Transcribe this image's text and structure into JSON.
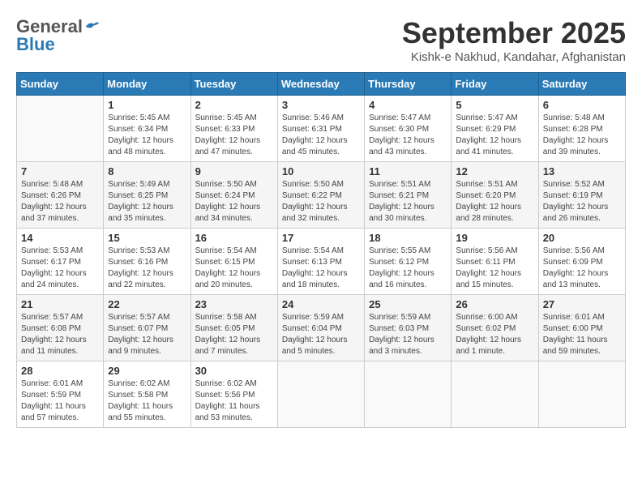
{
  "header": {
    "logo": {
      "general": "General",
      "blue": "Blue"
    },
    "title": "September 2025",
    "subtitle": "Kishk-e Nakhud, Kandahar, Afghanistan"
  },
  "weekdays": [
    "Sunday",
    "Monday",
    "Tuesday",
    "Wednesday",
    "Thursday",
    "Friday",
    "Saturday"
  ],
  "weeks": [
    [
      {
        "day": "",
        "info": ""
      },
      {
        "day": "1",
        "info": "Sunrise: 5:45 AM\nSunset: 6:34 PM\nDaylight: 12 hours\nand 48 minutes."
      },
      {
        "day": "2",
        "info": "Sunrise: 5:45 AM\nSunset: 6:33 PM\nDaylight: 12 hours\nand 47 minutes."
      },
      {
        "day": "3",
        "info": "Sunrise: 5:46 AM\nSunset: 6:31 PM\nDaylight: 12 hours\nand 45 minutes."
      },
      {
        "day": "4",
        "info": "Sunrise: 5:47 AM\nSunset: 6:30 PM\nDaylight: 12 hours\nand 43 minutes."
      },
      {
        "day": "5",
        "info": "Sunrise: 5:47 AM\nSunset: 6:29 PM\nDaylight: 12 hours\nand 41 minutes."
      },
      {
        "day": "6",
        "info": "Sunrise: 5:48 AM\nSunset: 6:28 PM\nDaylight: 12 hours\nand 39 minutes."
      }
    ],
    [
      {
        "day": "7",
        "info": "Sunrise: 5:48 AM\nSunset: 6:26 PM\nDaylight: 12 hours\nand 37 minutes."
      },
      {
        "day": "8",
        "info": "Sunrise: 5:49 AM\nSunset: 6:25 PM\nDaylight: 12 hours\nand 35 minutes."
      },
      {
        "day": "9",
        "info": "Sunrise: 5:50 AM\nSunset: 6:24 PM\nDaylight: 12 hours\nand 34 minutes."
      },
      {
        "day": "10",
        "info": "Sunrise: 5:50 AM\nSunset: 6:22 PM\nDaylight: 12 hours\nand 32 minutes."
      },
      {
        "day": "11",
        "info": "Sunrise: 5:51 AM\nSunset: 6:21 PM\nDaylight: 12 hours\nand 30 minutes."
      },
      {
        "day": "12",
        "info": "Sunrise: 5:51 AM\nSunset: 6:20 PM\nDaylight: 12 hours\nand 28 minutes."
      },
      {
        "day": "13",
        "info": "Sunrise: 5:52 AM\nSunset: 6:19 PM\nDaylight: 12 hours\nand 26 minutes."
      }
    ],
    [
      {
        "day": "14",
        "info": "Sunrise: 5:53 AM\nSunset: 6:17 PM\nDaylight: 12 hours\nand 24 minutes."
      },
      {
        "day": "15",
        "info": "Sunrise: 5:53 AM\nSunset: 6:16 PM\nDaylight: 12 hours\nand 22 minutes."
      },
      {
        "day": "16",
        "info": "Sunrise: 5:54 AM\nSunset: 6:15 PM\nDaylight: 12 hours\nand 20 minutes."
      },
      {
        "day": "17",
        "info": "Sunrise: 5:54 AM\nSunset: 6:13 PM\nDaylight: 12 hours\nand 18 minutes."
      },
      {
        "day": "18",
        "info": "Sunrise: 5:55 AM\nSunset: 6:12 PM\nDaylight: 12 hours\nand 16 minutes."
      },
      {
        "day": "19",
        "info": "Sunrise: 5:56 AM\nSunset: 6:11 PM\nDaylight: 12 hours\nand 15 minutes."
      },
      {
        "day": "20",
        "info": "Sunrise: 5:56 AM\nSunset: 6:09 PM\nDaylight: 12 hours\nand 13 minutes."
      }
    ],
    [
      {
        "day": "21",
        "info": "Sunrise: 5:57 AM\nSunset: 6:08 PM\nDaylight: 12 hours\nand 11 minutes."
      },
      {
        "day": "22",
        "info": "Sunrise: 5:57 AM\nSunset: 6:07 PM\nDaylight: 12 hours\nand 9 minutes."
      },
      {
        "day": "23",
        "info": "Sunrise: 5:58 AM\nSunset: 6:05 PM\nDaylight: 12 hours\nand 7 minutes."
      },
      {
        "day": "24",
        "info": "Sunrise: 5:59 AM\nSunset: 6:04 PM\nDaylight: 12 hours\nand 5 minutes."
      },
      {
        "day": "25",
        "info": "Sunrise: 5:59 AM\nSunset: 6:03 PM\nDaylight: 12 hours\nand 3 minutes."
      },
      {
        "day": "26",
        "info": "Sunrise: 6:00 AM\nSunset: 6:02 PM\nDaylight: 12 hours\nand 1 minute."
      },
      {
        "day": "27",
        "info": "Sunrise: 6:01 AM\nSunset: 6:00 PM\nDaylight: 11 hours\nand 59 minutes."
      }
    ],
    [
      {
        "day": "28",
        "info": "Sunrise: 6:01 AM\nSunset: 5:59 PM\nDaylight: 11 hours\nand 57 minutes."
      },
      {
        "day": "29",
        "info": "Sunrise: 6:02 AM\nSunset: 5:58 PM\nDaylight: 11 hours\nand 55 minutes."
      },
      {
        "day": "30",
        "info": "Sunrise: 6:02 AM\nSunset: 5:56 PM\nDaylight: 11 hours\nand 53 minutes."
      },
      {
        "day": "",
        "info": ""
      },
      {
        "day": "",
        "info": ""
      },
      {
        "day": "",
        "info": ""
      },
      {
        "day": "",
        "info": ""
      }
    ]
  ]
}
